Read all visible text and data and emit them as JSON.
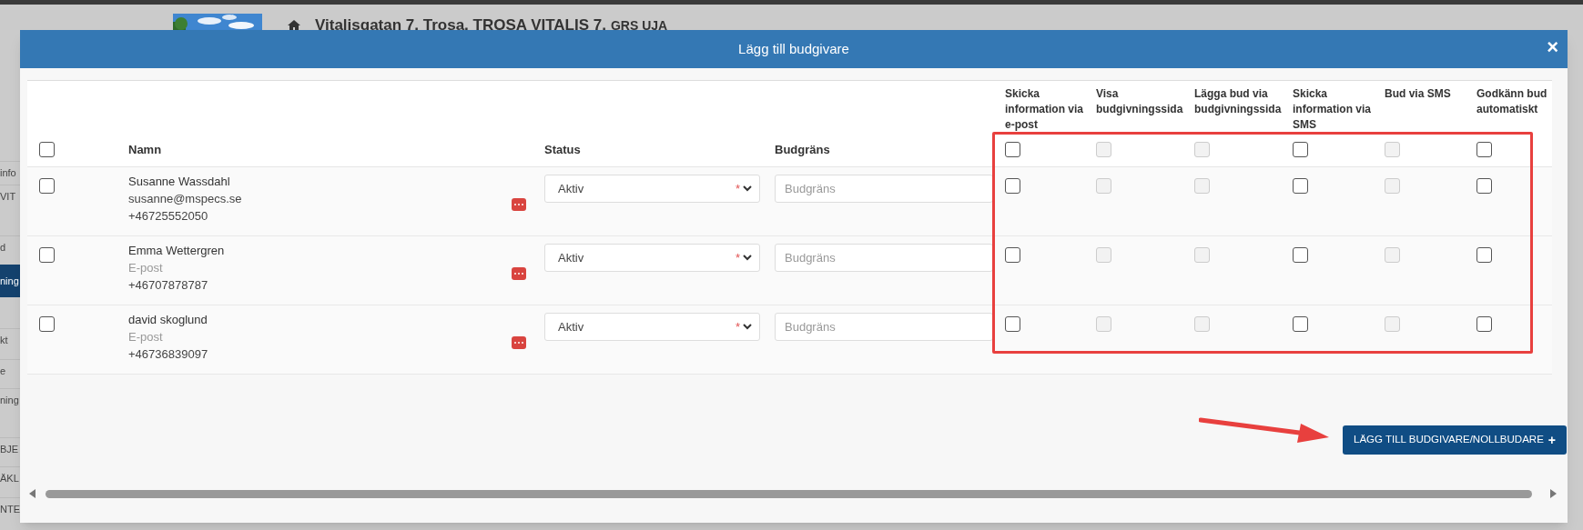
{
  "app": {
    "address": "Vitalisgatan 7, Trosa, TROSA VITALIS 7,",
    "address_suffix": "GRS UJA",
    "sidebar": [
      {
        "label": "info",
        "selected": false
      },
      {
        "label": "VIT",
        "selected": false
      },
      {
        "label": "d",
        "selected": false
      },
      {
        "label": "ning",
        "selected": true
      },
      {
        "label": "kt",
        "selected": false
      },
      {
        "label": "e",
        "selected": false
      },
      {
        "label": "ning",
        "selected": false
      },
      {
        "label": "BJE",
        "selected": false
      },
      {
        "label": "ÄKL",
        "selected": false
      },
      {
        "label": "NTE",
        "selected": false
      }
    ]
  },
  "modal": {
    "title": "Lägg till budgivare",
    "close": "×"
  },
  "table": {
    "select_all": {
      "checked": false
    },
    "columns": [
      "Namn",
      "Status",
      "Budgräns"
    ],
    "option_columns": [
      {
        "label": "Skicka information via e-post",
        "checked": false,
        "disabled": false
      },
      {
        "label": "Visa budgivningssida",
        "checked": false,
        "disabled": true
      },
      {
        "label": "Lägga bud via budgivningssida",
        "checked": false,
        "disabled": true
      },
      {
        "label": "Skicka information via SMS",
        "checked": false,
        "disabled": false
      },
      {
        "label": "Bud via SMS",
        "checked": false,
        "disabled": true
      },
      {
        "label": "Godkänn bud automatiskt",
        "checked": false,
        "disabled": false
      }
    ],
    "rows": [
      {
        "checked": false,
        "name": "Susanne Wassdahl",
        "email": {
          "value": "susanne@mspecs.se"
        },
        "phone": "+46725552050",
        "status": "Aktiv",
        "required_mark": "*",
        "budget": {
          "placeholder": "Budgräns"
        },
        "options": [
          {
            "checked": false,
            "disabled": false
          },
          {
            "checked": false,
            "disabled": true
          },
          {
            "checked": false,
            "disabled": true
          },
          {
            "checked": false,
            "disabled": false
          },
          {
            "checked": false,
            "disabled": true
          },
          {
            "checked": false,
            "disabled": false
          }
        ]
      },
      {
        "checked": false,
        "name": "Emma Wettergren",
        "email": {
          "placeholder": "E-post"
        },
        "phone": "+46707878787",
        "status": "Aktiv",
        "required_mark": "*",
        "budget": {
          "placeholder": "Budgräns"
        },
        "options": [
          {
            "checked": false,
            "disabled": false
          },
          {
            "checked": false,
            "disabled": true
          },
          {
            "checked": false,
            "disabled": true
          },
          {
            "checked": false,
            "disabled": false
          },
          {
            "checked": false,
            "disabled": true
          },
          {
            "checked": false,
            "disabled": false
          }
        ]
      },
      {
        "checked": false,
        "name": "david skoglund",
        "email": {
          "placeholder": "E-post"
        },
        "phone": "+46736839097",
        "status": "Aktiv",
        "required_mark": "*",
        "budget": {
          "placeholder": "Budgräns"
        },
        "options": [
          {
            "checked": false,
            "disabled": false
          },
          {
            "checked": false,
            "disabled": true
          },
          {
            "checked": false,
            "disabled": true
          },
          {
            "checked": false,
            "disabled": false
          },
          {
            "checked": false,
            "disabled": true
          },
          {
            "checked": false,
            "disabled": false
          }
        ]
      }
    ]
  },
  "add_button": {
    "label": "LÄGG TILL BUDGIVARE/NOLLBUDARE",
    "icon": "+"
  }
}
